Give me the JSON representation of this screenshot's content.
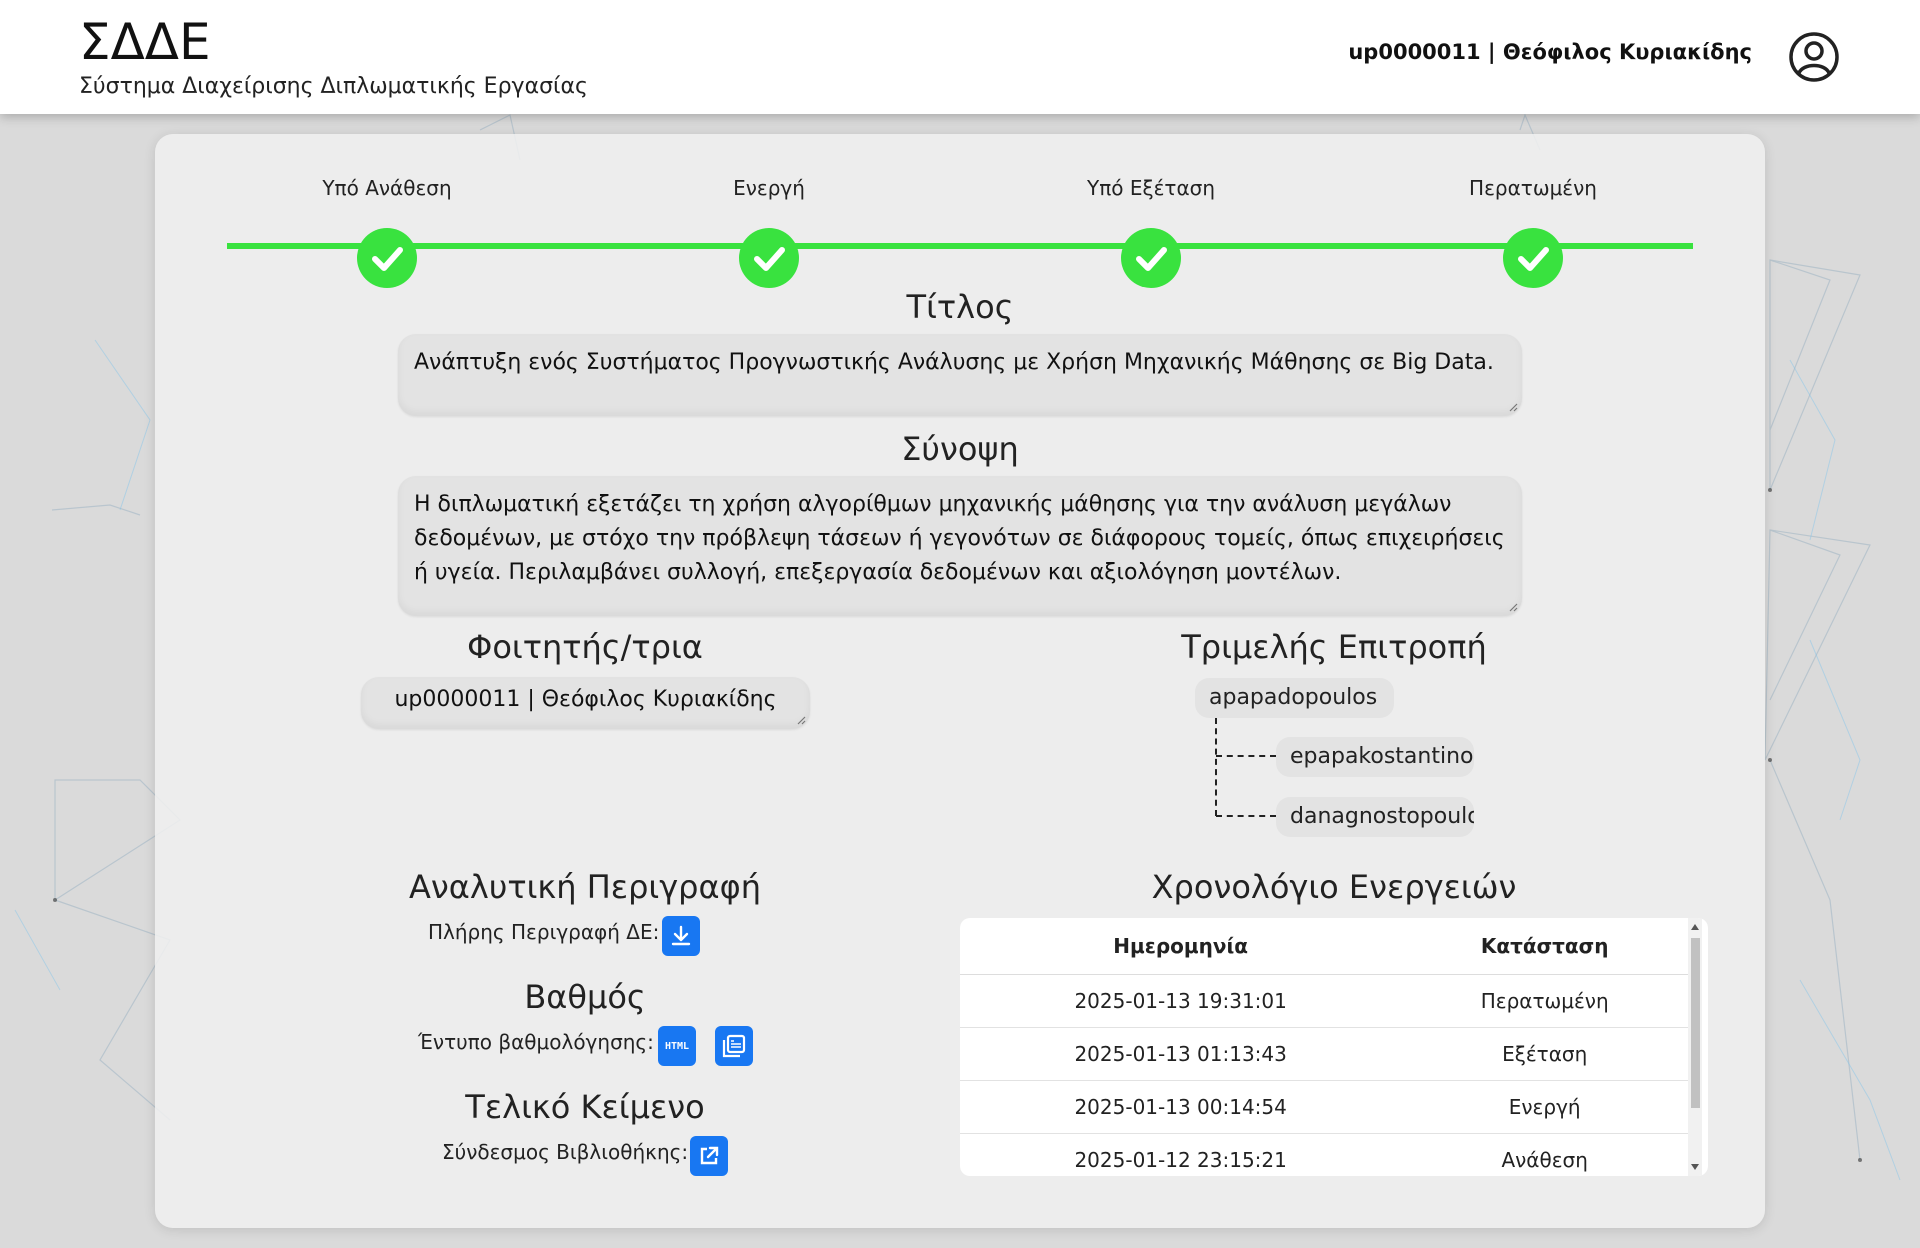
{
  "header": {
    "title": "ΣΔΔΕ",
    "subtitle": "Σύστημα Διαχείρισης Διπλωματικής Εργασίας",
    "user": "up0000011 | Θεόφιλος Κυριακίδης"
  },
  "progress": {
    "steps": [
      {
        "label": "Υπό Ανάθεση",
        "done": true
      },
      {
        "label": "Ενεργή",
        "done": true
      },
      {
        "label": "Υπό Εξέταση",
        "done": true
      },
      {
        "label": "Περατωμένη",
        "done": true
      }
    ],
    "color": "#39e23f"
  },
  "thesis": {
    "title_heading": "Τίτλος",
    "title": "Ανάπτυξη ενός Συστήματος Προγνωστικής Ανάλυσης με Χρήση Μηχανικής Μάθησης σε Big Data.",
    "summary_heading": "Σύνοψη",
    "summary": "Η διπλωματική εξετάζει τη χρήση αλγορίθμων μηχανικής μάθησης για την ανάλυση μεγάλων δεδομένων, με στόχο την πρόβλεψη τάσεων ή γεγονότων σε διάφορους τομείς, όπως επιχειρήσεις ή υγεία. Περιλαμβάνει συλλογή, επεξεργασία δεδομένων και αξιολόγηση μοντέλων."
  },
  "student": {
    "heading": "Φοιτητής/τρια",
    "value": "up0000011 | Θεόφιλος Κυριακίδης"
  },
  "committee": {
    "heading": "Τριμελής Επιτροπή",
    "supervisor": "apapadopoulos",
    "members": [
      "epapakostantinou",
      "danagnostopoulos"
    ]
  },
  "description": {
    "heading": "Αναλυτική Περιγραφή",
    "label": "Πλήρης Περιγραφή ΔΕ:",
    "download_icon": "download-icon"
  },
  "grade": {
    "heading": "Βαθμός",
    "label": "Έντυπο βαθμολόγησης:",
    "html_icon_text": "HTML"
  },
  "final_text": {
    "heading": "Τελικό Κείμενο",
    "label": "Σύνδεσμος Βιβλιοθήκης:",
    "link_icon": "external-link-icon"
  },
  "log": {
    "heading": "Χρονολόγιο Ενεργειών",
    "columns": [
      "Ημερομηνία",
      "Κατάσταση"
    ],
    "rows": [
      [
        "2025-01-13 19:31:01",
        "Περατωμένη"
      ],
      [
        "2025-01-13 01:13:43",
        "Εξέταση"
      ],
      [
        "2025-01-13 00:14:54",
        "Ενεργή"
      ],
      [
        "2025-01-12 23:15:21",
        "Ανάθεση"
      ]
    ]
  },
  "colors": {
    "accent_blue": "#1877f2",
    "success_green": "#39e23f"
  }
}
